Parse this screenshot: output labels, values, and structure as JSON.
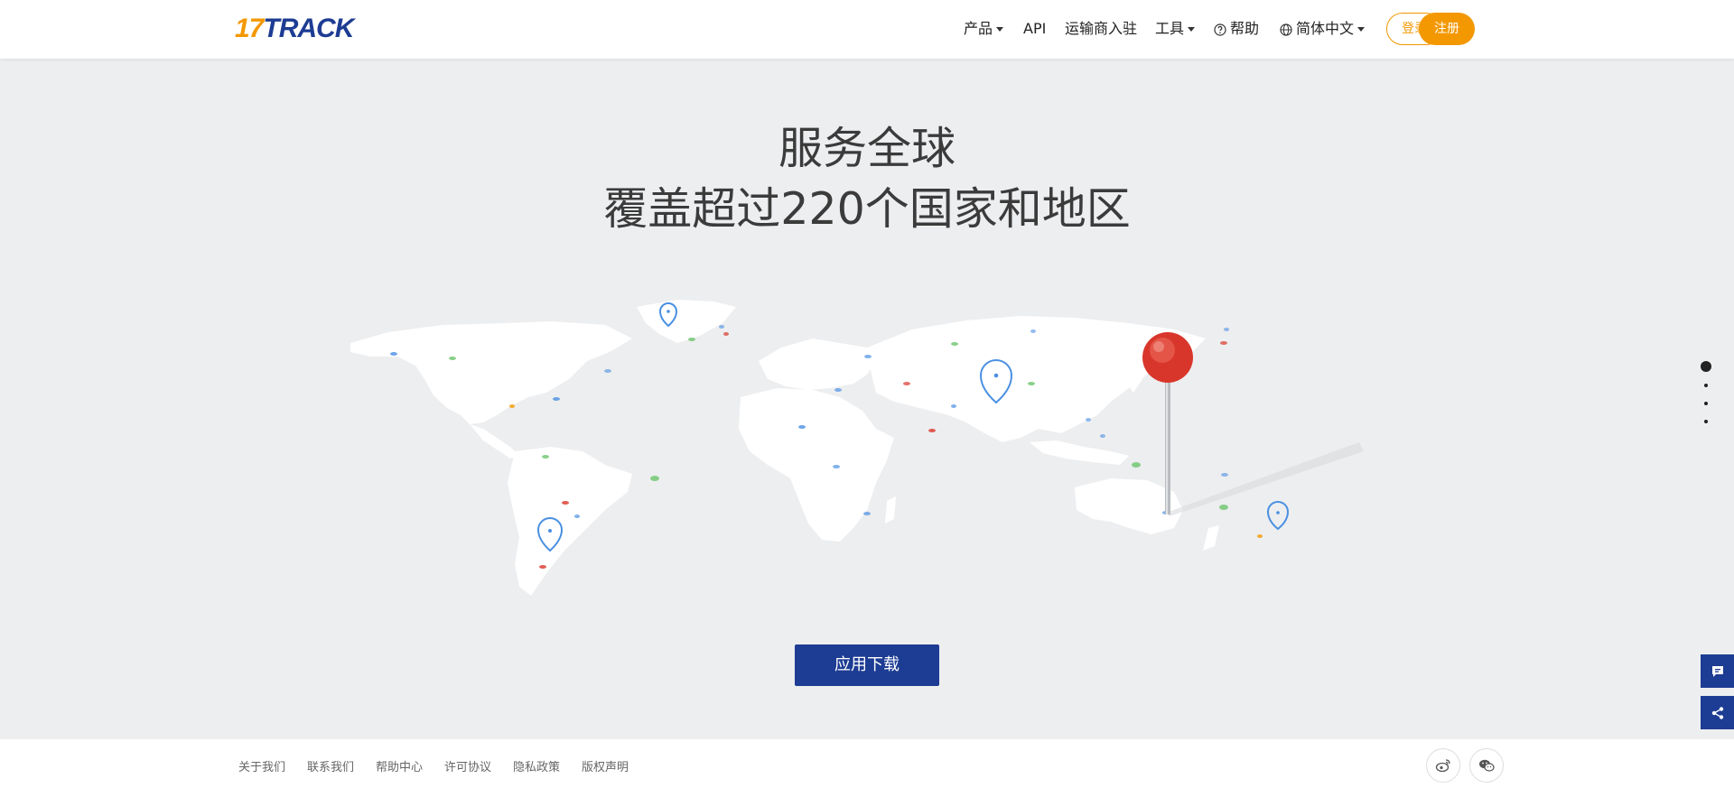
{
  "header": {
    "logo_num": "17",
    "logo_text": "TRACK",
    "nav": {
      "products": "产品",
      "api": "API",
      "carrier_join": "运输商入驻",
      "tools": "工具",
      "help": "帮助",
      "language": "简体中文"
    },
    "login": "登录",
    "register": "注册"
  },
  "hero": {
    "title_line1": "服务全球",
    "title_line2": "覆盖超过220个国家和地区"
  },
  "download_button": "应用下载",
  "pagination_dots": {
    "count": 4,
    "active_index": 0
  },
  "side_buttons": [
    "chat-icon",
    "share-icon"
  ],
  "footer": {
    "links": [
      "关于我们",
      "联系我们",
      "帮助中心",
      "许可协议",
      "隐私政策",
      "版权声明"
    ],
    "social": [
      "weibo-icon",
      "wechat-icon"
    ]
  },
  "colors": {
    "brand_blue": "#1d3c93",
    "brand_orange": "#f39800",
    "page_bg": "#edeef0",
    "pin_red": "#d9362b",
    "pin_blue": "#4a90e2"
  }
}
